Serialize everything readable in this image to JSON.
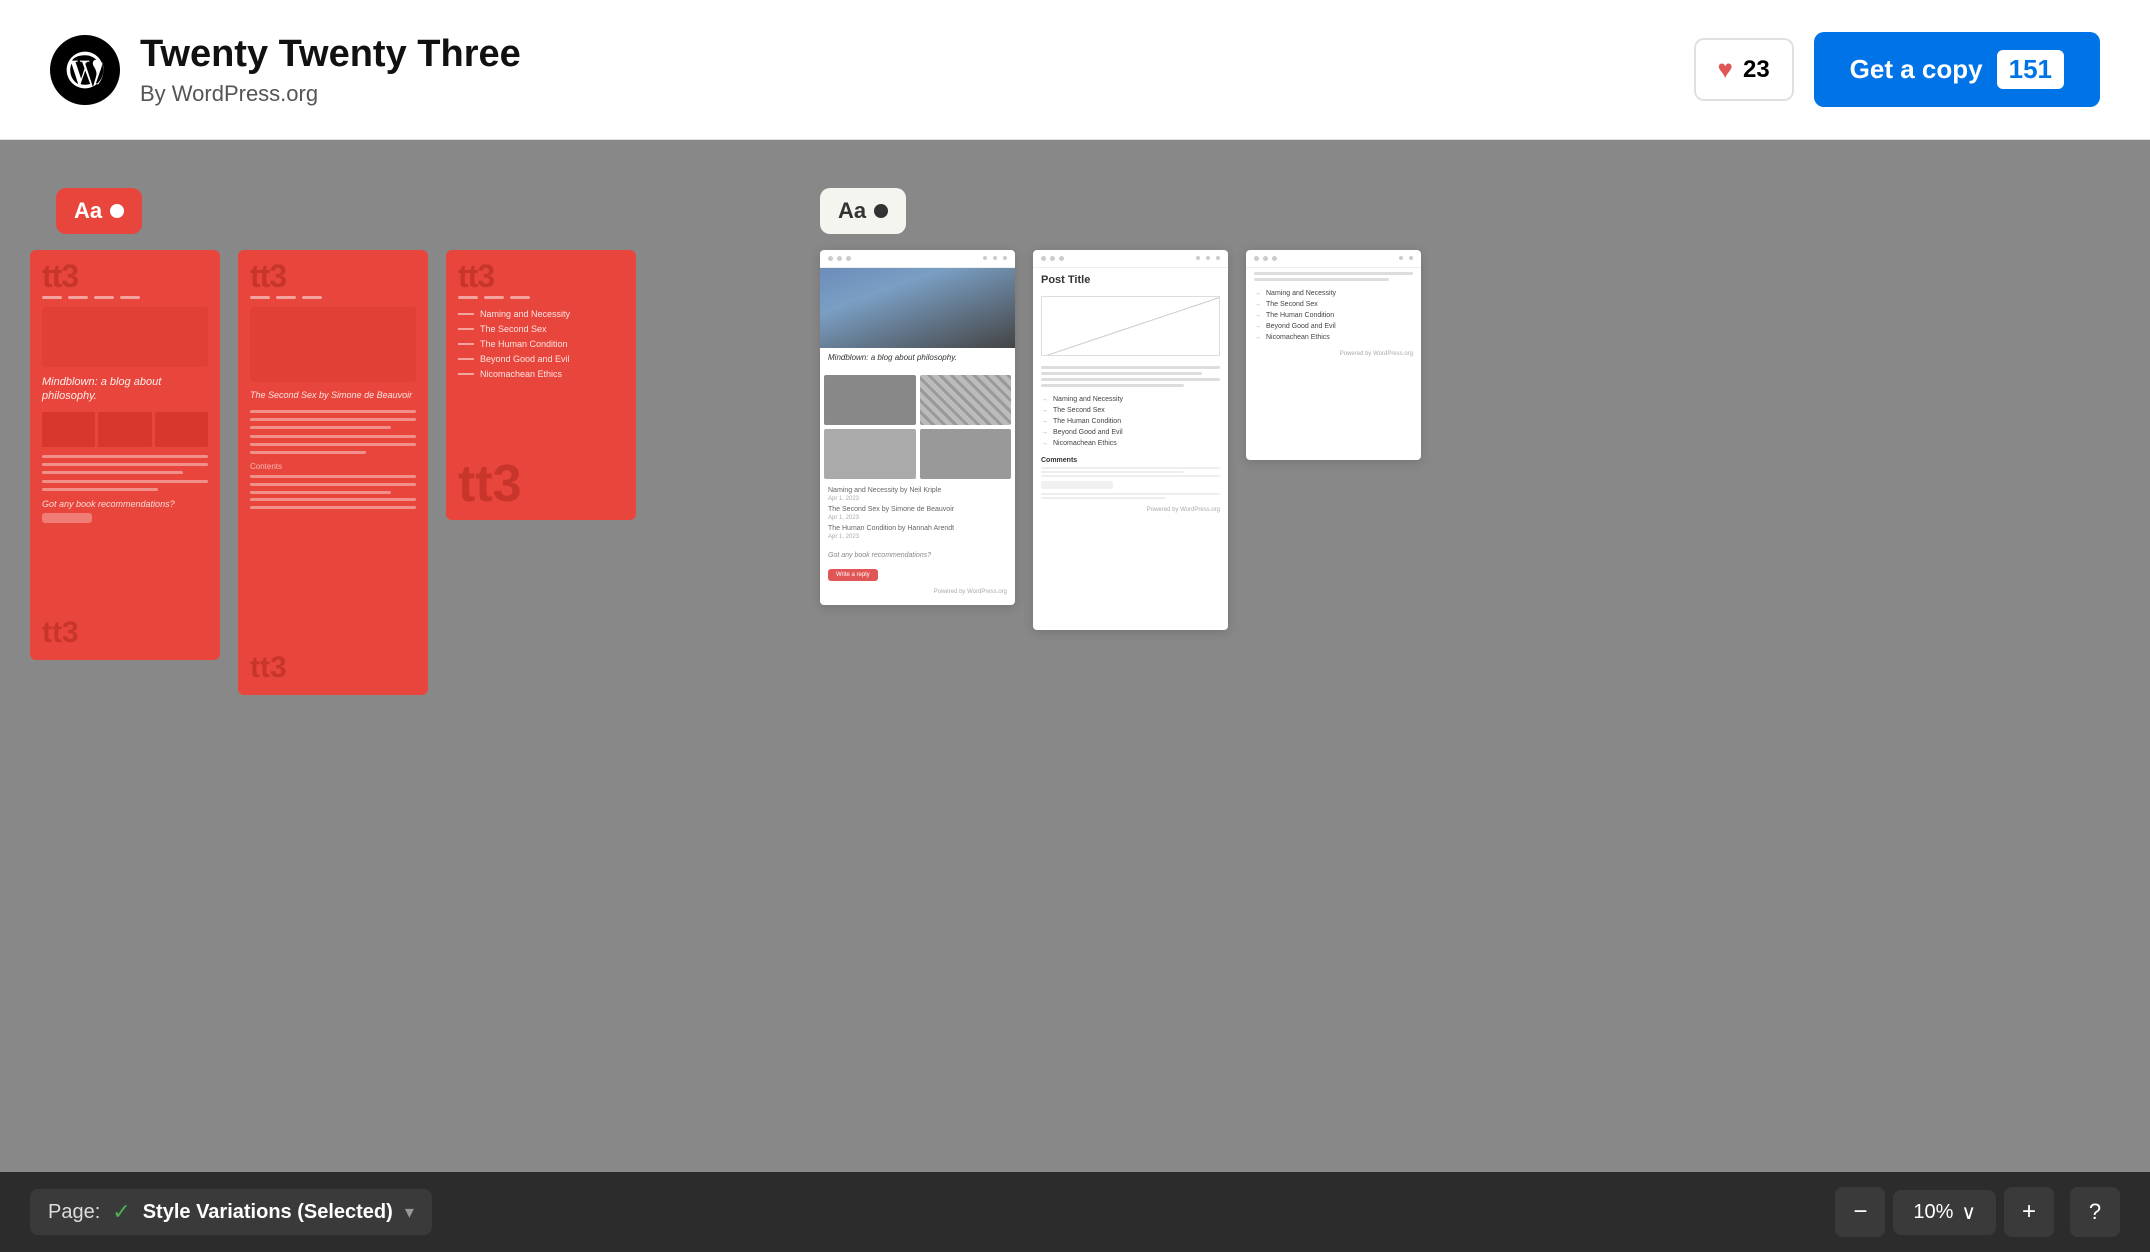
{
  "header": {
    "title": "Twenty Twenty Three",
    "author": "By WordPress.org",
    "like_count": "23",
    "get_copy_label": "Get a copy",
    "get_copy_count": "151"
  },
  "left_style_badge": {
    "text": "Aa",
    "dot": true
  },
  "right_style_badge": {
    "text": "Aa",
    "dot": true
  },
  "red_previews": {
    "card1": {
      "title": "tt3",
      "blog": "Mindblown: a blog about philosophy.",
      "footer": "tt3"
    },
    "card2": {
      "title": "tt3",
      "text": "The Second Sex by Simone de Beauvoir",
      "footer": "tt3"
    },
    "card3": {
      "title": "tt3",
      "items": [
        "Naming and Necessity",
        "The Second Sex",
        "The Human Condition",
        "Beyond Good and Evil",
        "Nicomachean Ethics"
      ],
      "footer": "tt3"
    }
  },
  "white_previews": {
    "card1": {
      "blog_title": "Mindblown: a blog about philosophy.",
      "items": [
        "Naming and Necessity by Neil Kriple",
        "The Second Sex by Simone de Beauvoir",
        "The Human Condition by Hannah Arendt"
      ]
    },
    "card2": {
      "post_title": "Post Title",
      "items": [
        "Naming and Necessity",
        "The Second Sex",
        "The Human Condition",
        "Beyond Good and Evil",
        "Nicomachean Ethics"
      ]
    },
    "card3": {
      "items": [
        "Naming and Necessity",
        "The Second Sex",
        "The Human Condition",
        "Beyond Good and Evil",
        "Nicomachean Ethics"
      ]
    }
  },
  "bottom_toolbar": {
    "page_label": "Page:",
    "check_icon": "✓",
    "page_value": "Style Variations (Selected)",
    "chevron": "▾",
    "zoom_minus": "−",
    "zoom_value": "10%",
    "zoom_chevron": "∨",
    "zoom_plus": "+",
    "help": "?"
  }
}
